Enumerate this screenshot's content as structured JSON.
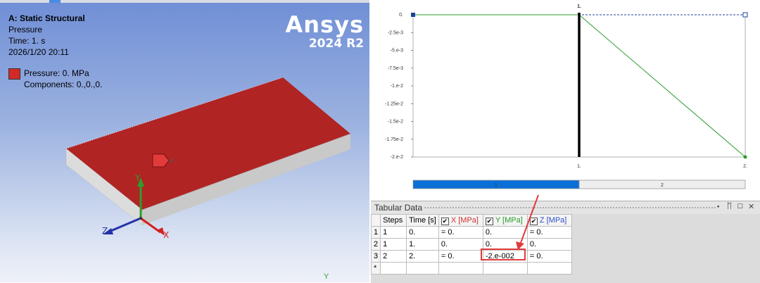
{
  "viewport": {
    "title": "A: Static Structural",
    "subtitle": "Pressure",
    "time": "Time: 1. s",
    "date": "2026/1/20 20:11",
    "legend_label": "Pressure: 0. MPa",
    "legend_components": "Components: 0.,0.,0.",
    "brand_name": "Ansys",
    "brand_version": "2024 R2",
    "axis_x": "X",
    "axis_y": "Y",
    "axis_z": "Z",
    "bottom_y": "Y",
    "pressure_color": "#b02424"
  },
  "chart_data": {
    "type": "line",
    "yticks": [
      "0.",
      "-2.5e-3",
      "-5.e-3",
      "-7.5e-3",
      "-1.e-2",
      "-1.25e-2",
      "-1.5e-2",
      "-1.75e-2",
      "-2.e-2"
    ],
    "xticks": [
      "1.",
      "2."
    ],
    "top_label": "1.",
    "ylim": [
      -0.02,
      0
    ],
    "xlim": [
      0,
      2
    ],
    "series": [
      {
        "color": "#1f3f9e",
        "x": [
          0,
          1,
          2
        ],
        "y": [
          0,
          0,
          0
        ]
      },
      {
        "color": "#2b9b2b",
        "x": [
          0,
          1,
          2
        ],
        "y": [
          0,
          0,
          -0.02
        ]
      }
    ],
    "current_time": 1,
    "steps": [
      {
        "label": "1",
        "active": true
      },
      {
        "label": "2",
        "active": false
      }
    ]
  },
  "tabular": {
    "title": "Tabular Data",
    "buttons": "▾ ᛖ □ ✕",
    "headers": {
      "steps": "Steps",
      "time": "Time [s]",
      "x": "X [MPa]",
      "y": "Y [MPa]",
      "z": "Z [MPa]"
    },
    "check": "✔",
    "rows": [
      {
        "idx": "1",
        "step": "1",
        "time": "0.",
        "x": "= 0.",
        "y": "0.",
        "z": "= 0."
      },
      {
        "idx": "2",
        "step": "1",
        "time": "1.",
        "x": "0.",
        "y": "0.",
        "z": "0."
      },
      {
        "idx": "3",
        "step": "2",
        "time": "2.",
        "x": "= 0.",
        "y": "-2.e-002",
        "z": "= 0."
      }
    ],
    "new_row": "*"
  }
}
